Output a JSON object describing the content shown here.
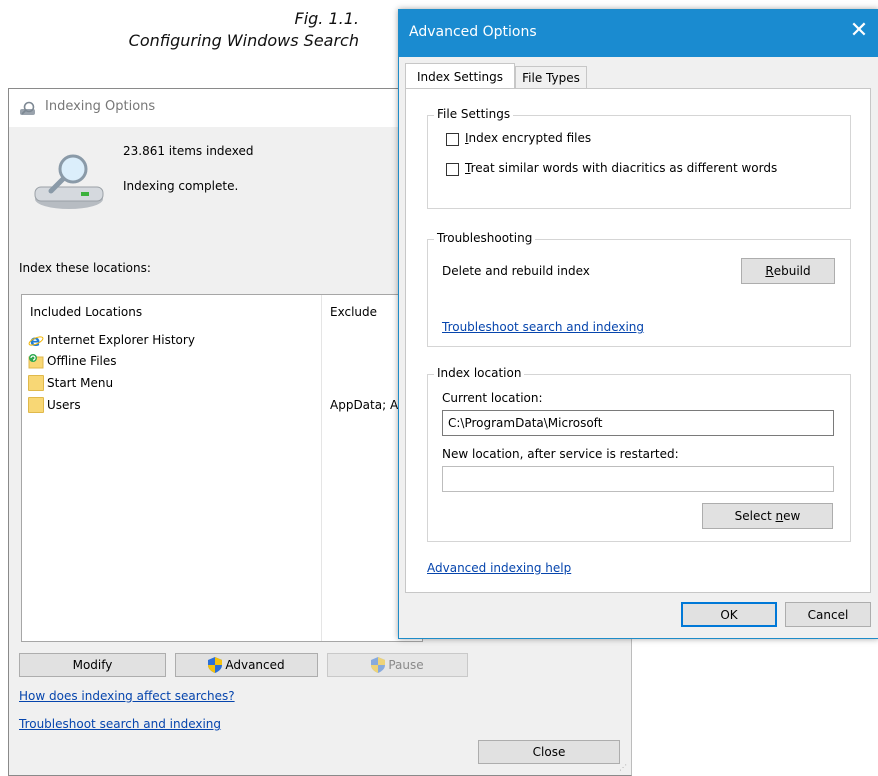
{
  "caption": {
    "line1": "Fig. 1.1.",
    "line2": "Configuring Windows Search"
  },
  "indexing_window": {
    "title": "Indexing Options",
    "items_indexed": "23.861 items indexed",
    "status": "Indexing complete.",
    "locations_label": "Index these locations:",
    "columns": [
      "Included Locations",
      "Exclude"
    ],
    "locations": [
      {
        "name": "Internet Explorer History",
        "icon": "ie-icon",
        "exclude": ""
      },
      {
        "name": "Offline Files",
        "icon": "offline-files-icon",
        "exclude": ""
      },
      {
        "name": "Start Menu",
        "icon": "folder-icon",
        "exclude": ""
      },
      {
        "name": "Users",
        "icon": "folder-icon",
        "exclude": "AppData; A"
      }
    ],
    "buttons": {
      "modify": "Modify",
      "advanced": "Advanced",
      "pause": "Pause",
      "close": "Close"
    },
    "links": {
      "how": "How does indexing affect searches?",
      "troubleshoot": "Troubleshoot search and indexing"
    }
  },
  "advanced_dialog": {
    "title": "Advanced Options",
    "tabs": [
      "Index Settings",
      "File Types"
    ],
    "file_settings": {
      "title": "File Settings",
      "options": [
        {
          "key": "I",
          "rest": "ndex encrypted files",
          "checked": false
        },
        {
          "key": "T",
          "rest": "reat similar words with diacritics as different words",
          "checked": false
        }
      ]
    },
    "troubleshooting": {
      "title": "Troubleshooting",
      "rebuild_label": "Delete and rebuild index",
      "rebuild_key": "R",
      "rebuild_rest": "ebuild",
      "link": "Troubleshoot search and indexing"
    },
    "index_location": {
      "title": "Index location",
      "current_label": "Current location:",
      "current_value": "C:\\ProgramData\\Microsoft",
      "new_label": "New location, after service is restarted:",
      "new_value": "",
      "select_prefix": "Select ",
      "select_key": "n",
      "select_rest": "ew"
    },
    "help_link": "Advanced indexing help",
    "ok": "OK",
    "cancel": "Cancel"
  },
  "colors": {
    "accent": "#1a8bd0",
    "link": "#0645ad"
  }
}
